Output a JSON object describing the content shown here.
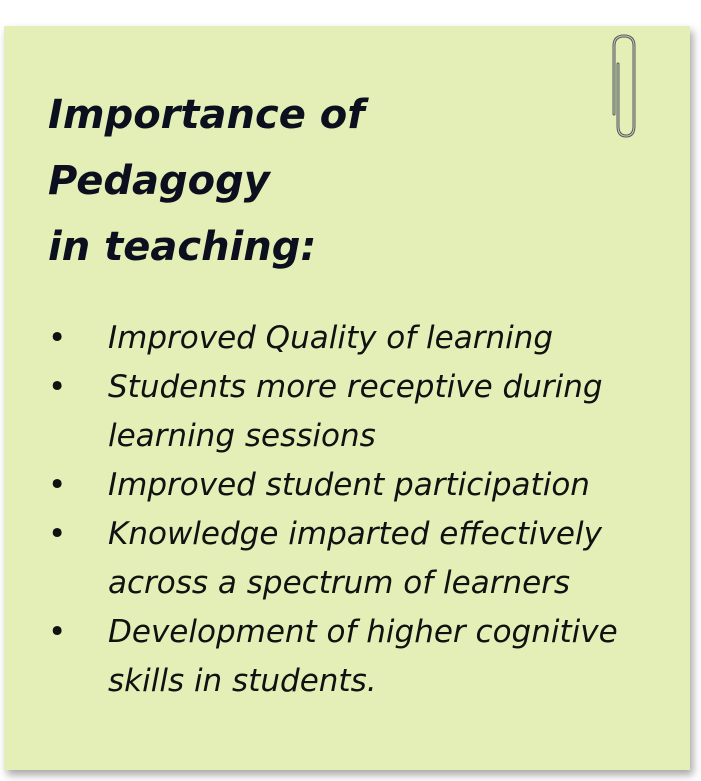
{
  "note": {
    "background_color": "#e3efb6",
    "icon": "paperclip-icon",
    "title_lines": [
      "Importance of",
      "Pedagogy",
      "in teaching:"
    ],
    "bullet_glyph": "•",
    "bullets": [
      {
        "lines": [
          "Improved Quality of learning"
        ]
      },
      {
        "lines": [
          "Students more receptive during",
          "learning sessions"
        ]
      },
      {
        "lines": [
          "Improved student participation"
        ]
      },
      {
        "lines": [
          "Knowledge imparted effectively",
          "across a spectrum of learners"
        ]
      },
      {
        "lines": [
          "Development of higher cognitive",
          "skills in students."
        ]
      }
    ]
  }
}
